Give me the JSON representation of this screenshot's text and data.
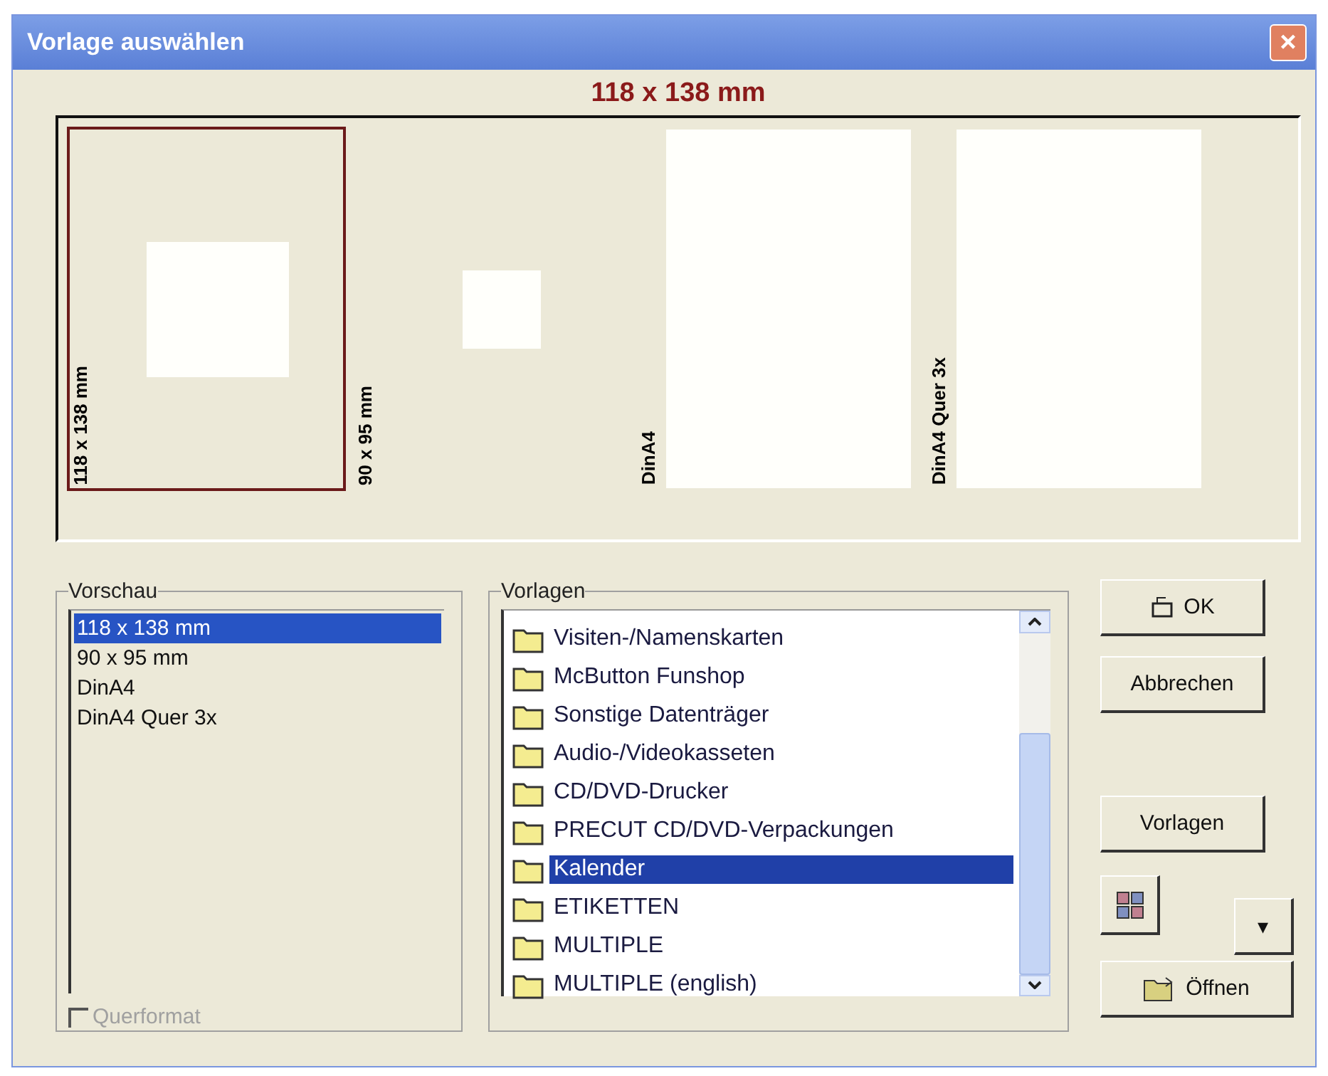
{
  "window": {
    "title": "Vorlage auswählen",
    "close": "×"
  },
  "heading": "118 x 138 mm",
  "templates": [
    {
      "label": "118 x 138 mm",
      "selected": true,
      "kind": "square"
    },
    {
      "label": "90 x 95 mm",
      "selected": false,
      "kind": "small"
    },
    {
      "label": "DinA4",
      "selected": false,
      "kind": "portrait"
    },
    {
      "label": "DinA4 Quer 3x",
      "selected": false,
      "kind": "portrait"
    }
  ],
  "preview": {
    "title": "Vorschau",
    "items": [
      {
        "label": "118 x 138 mm",
        "selected": true
      },
      {
        "label": "90 x 95 mm",
        "selected": false
      },
      {
        "label": "DinA4",
        "selected": false
      },
      {
        "label": "DinA4 Quer 3x",
        "selected": false
      }
    ],
    "landscape": {
      "label": "Querformat",
      "checked": false,
      "disabled": true
    }
  },
  "library": {
    "title": "Vorlagen",
    "items": [
      {
        "label": "Visiten-/Namenskarten",
        "selected": false
      },
      {
        "label": "McButton Funshop",
        "selected": false
      },
      {
        "label": "Sonstige Datenträger",
        "selected": false
      },
      {
        "label": "Audio-/Videokasseten",
        "selected": false
      },
      {
        "label": "CD/DVD-Drucker",
        "selected": false
      },
      {
        "label": "PRECUT CD/DVD-Verpackungen",
        "selected": false
      },
      {
        "label": "Kalender",
        "selected": true
      },
      {
        "label": "ETIKETTEN",
        "selected": false
      },
      {
        "label": "MULTIPLE",
        "selected": false
      },
      {
        "label": "MULTIPLE (english)",
        "selected": false
      }
    ]
  },
  "buttons": {
    "ok": "OK",
    "cancel": "Abbrechen",
    "templates": "Vorlagen",
    "dropdown": "▾",
    "open": "Öffnen"
  }
}
